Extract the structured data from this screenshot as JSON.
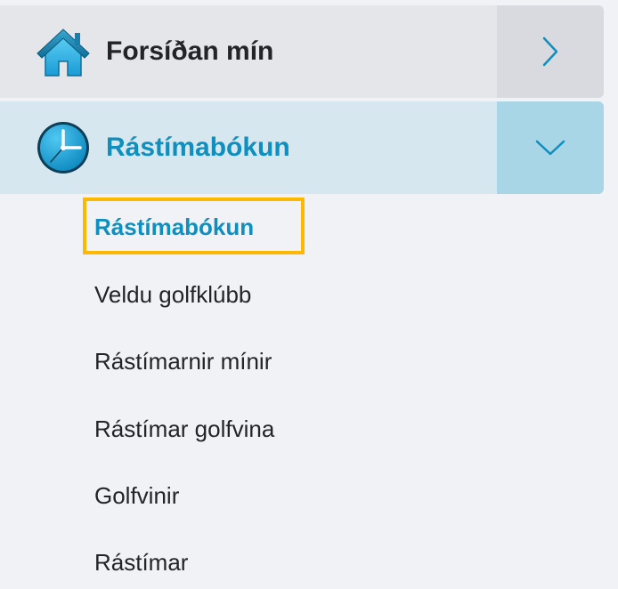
{
  "menu": {
    "items": [
      {
        "label": "Forsíðan mín",
        "icon": "home-icon",
        "toggle_icon": "chevron-right-icon",
        "expanded": false
      },
      {
        "label": "Rástímabókun",
        "icon": "clock-icon",
        "toggle_icon": "chevron-down-icon",
        "expanded": true
      }
    ],
    "submenu": [
      {
        "label": "Rástímabókun",
        "active": true
      },
      {
        "label": "Veldu golfklúbb"
      },
      {
        "label": "Rástímarnir mínir"
      },
      {
        "label": "Rástímar golfvina"
      },
      {
        "label": "Golfvinir"
      },
      {
        "label": "Rástímar"
      }
    ]
  },
  "colors": {
    "accent": "#0e8fbe",
    "focus": "#ffb800",
    "home_row_bg": "#e5e6ea",
    "active_row_bg": "#d6e7ef",
    "active_toggle_bg": "#a8d6e6"
  }
}
